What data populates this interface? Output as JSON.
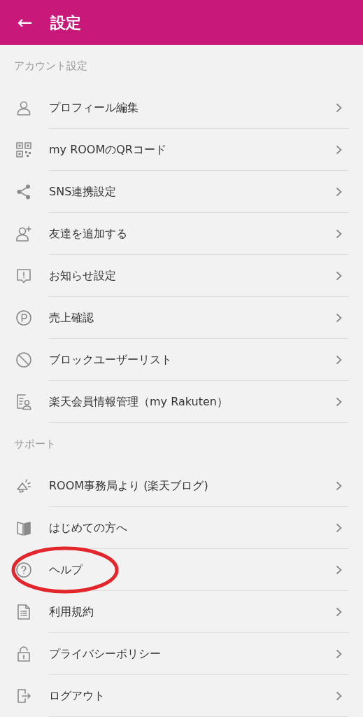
{
  "header": {
    "back_icon": "←",
    "title": "設定"
  },
  "sections": [
    {
      "title": "アカウント設定",
      "items": [
        {
          "kind": "person",
          "label": "プロフィール編集",
          "circled": false
        },
        {
          "kind": "qr",
          "label": "my ROOMのQRコード",
          "circled": false
        },
        {
          "kind": "share",
          "label": "SNS連携設定",
          "circled": false
        },
        {
          "kind": "person-add",
          "label": "友達を追加する",
          "circled": false
        },
        {
          "kind": "notice",
          "label": "お知らせ設定",
          "circled": false
        },
        {
          "kind": "points",
          "label": "売上確認",
          "circled": false
        },
        {
          "kind": "block",
          "label": "ブロックユーザーリスト",
          "circled": false
        },
        {
          "kind": "member",
          "label": "楽天会員情報管理（my Rakuten）",
          "circled": false
        }
      ]
    },
    {
      "title": "サポート",
      "items": [
        {
          "kind": "megaphone",
          "label": "ROOM事務局より (楽天ブログ)",
          "circled": false
        },
        {
          "kind": "book",
          "label": "はじめての方へ",
          "circled": false
        },
        {
          "kind": "help",
          "label": "ヘルプ",
          "circled": true
        },
        {
          "kind": "document",
          "label": "利用規約",
          "circled": false
        },
        {
          "kind": "lock",
          "label": "プライバシーポリシー",
          "circled": false
        },
        {
          "kind": "logout",
          "label": "ログアウト",
          "circled": false
        }
      ]
    }
  ]
}
